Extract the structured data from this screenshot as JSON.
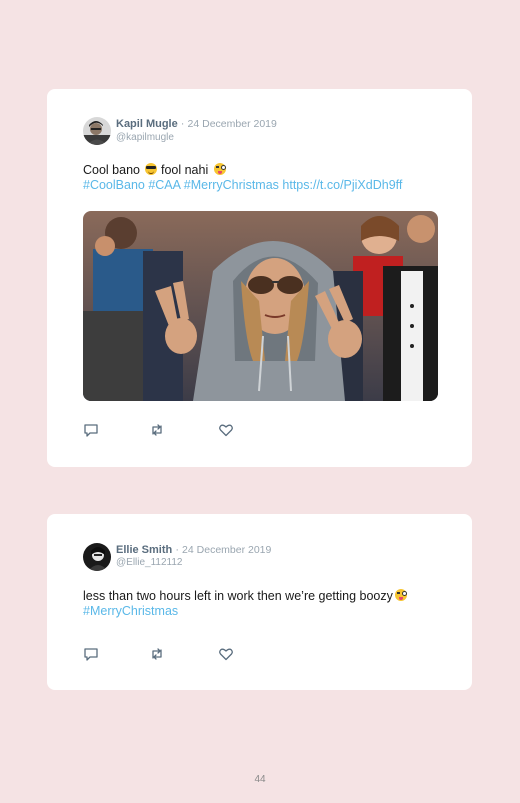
{
  "tweets": [
    {
      "author_name": "Kapil Mugle",
      "separator": "·",
      "date": "24 December 2019",
      "handle": "@kapilmugle",
      "text_part1": "Cool bano",
      "text_part2": "fool nahi",
      "emoji1": "sunglasses-face-emoji",
      "emoji2": "winking-tongue-face-emoji",
      "hashtags": "#CoolBano #CAA #MerryChristmas",
      "link": "https://t.co/PjiXdDh9ff",
      "media": "animated gif"
    },
    {
      "author_name": "Ellie Smith",
      "separator": "·",
      "date": "24 December 2019",
      "handle": "@Ellie_112112",
      "text_part1": "less than two hours left in work then we’re getting boozy",
      "emoji1": "zany-face-emoji",
      "hashtags": "#MerryChristmas"
    }
  ],
  "page_number": "44",
  "colors": {
    "background": "#f5e3e4",
    "card": "#ffffff",
    "link": "#5ab8e8",
    "muted": "#9aa6b0",
    "name": "#5a6d7e"
  },
  "icons": [
    "reply-icon",
    "retweet-icon",
    "like-icon"
  ]
}
